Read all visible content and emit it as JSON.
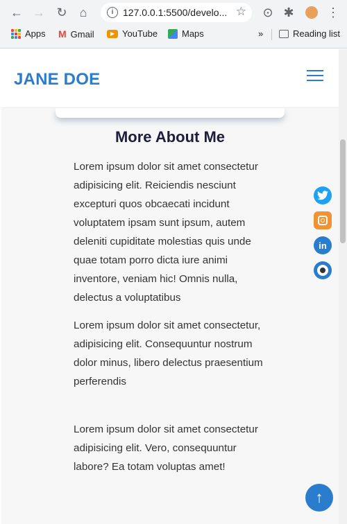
{
  "browser": {
    "url": "127.0.0.1:5500/develo...",
    "bookmarks": [
      {
        "label": "Apps",
        "icon": "apps-grid-icon"
      },
      {
        "label": "Gmail",
        "icon": "gmail-icon"
      },
      {
        "label": "YouTube",
        "icon": "youtube-icon"
      },
      {
        "label": "Maps",
        "icon": "maps-icon"
      }
    ],
    "overflow": "»",
    "reading_list": "Reading list"
  },
  "header": {
    "logo": "JANE DOE"
  },
  "about": {
    "heading": "More About Me",
    "paragraphs": [
      "Lorem ipsum dolor sit amet consectetur adipisicing elit. Reiciendis nesciunt excepturi quos obcaecati incidunt voluptatem ipsam sunt ipsum, autem deleniti cupiditate molestias quis unde quae totam porro dicta iure animi inventore, veniam hic! Omnis nulla, delectus a voluptatibus",
      "Lorem ipsum dolor sit amet consectetur, adipisicing elit. Consequuntur nostrum dolor minus, libero delectus praesentium perferendis",
      "Lorem ipsum dolor sit amet consectetur adipisicing elit. Vero, consequuntur labore? Ea totam voluptas amet!"
    ]
  },
  "social": [
    {
      "name": "twitter-icon",
      "glyph": "🐦",
      "color": "#1da1f2"
    },
    {
      "name": "instagram-icon",
      "glyph": "◙",
      "color": "#f09433"
    },
    {
      "name": "linkedin-icon",
      "glyph": "in",
      "color": "#0a66c2"
    },
    {
      "name": "github-icon",
      "glyph": "◉",
      "color": "#2a7ccd"
    }
  ],
  "back_to_top": "↑",
  "colors": {
    "brand": "#2a7ccd",
    "heading": "#1e1e3c"
  }
}
